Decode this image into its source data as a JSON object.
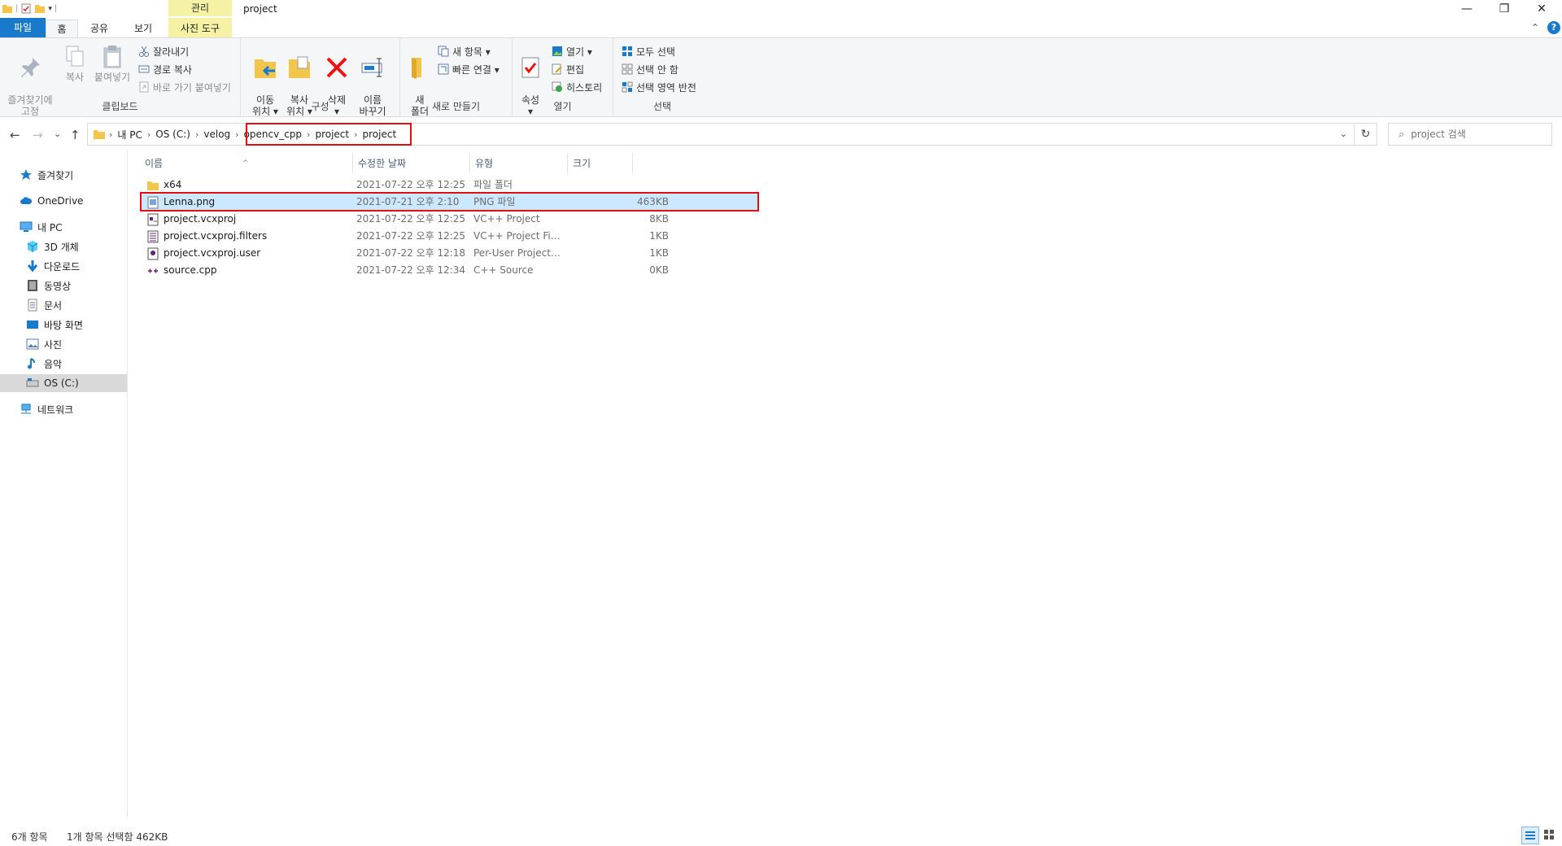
{
  "window": {
    "title": "project",
    "context_tab_label": "관리",
    "minimize": "—",
    "restore": "❐",
    "close": "✕"
  },
  "tabs": {
    "file": "파일",
    "home": "홈",
    "share": "공유",
    "view": "보기",
    "picture_tools": "사진 도구",
    "collapse": "⌃",
    "help": "?"
  },
  "ribbon": {
    "clipboard": {
      "label": "클립보드",
      "pin": "즐겨찾기에\n고정",
      "copy": "복사",
      "paste": "붙여넣기",
      "cut": "잘라내기",
      "copy_path": "경로 복사",
      "paste_shortcut": "바로 가기 붙여넣기"
    },
    "organize": {
      "label": "구성",
      "move_to": "이동\n위치 ▾",
      "copy_to": "복사\n위치 ▾",
      "delete": "삭제\n▾",
      "rename": "이름\n바꾸기"
    },
    "new": {
      "label": "새로 만들기",
      "new_folder": "새\n폴더",
      "new_item": "새 항목 ▾",
      "easy_access": "빠른 연결 ▾"
    },
    "open": {
      "label": "열기",
      "properties": "속성\n▾",
      "open": "열기 ▾",
      "edit": "편집",
      "history": "히스토리"
    },
    "select": {
      "label": "선택",
      "select_all": "모두 선택",
      "select_none": "선택 안 함",
      "invert": "선택 영역 반전"
    }
  },
  "address": {
    "back": "←",
    "forward": "→",
    "recent": "⌄",
    "up": "↑",
    "crumbs": [
      "내 PC",
      "OS (C:)",
      "velog",
      "opencv_cpp",
      "project",
      "project"
    ],
    "dropdown": "⌄",
    "refresh": "↻",
    "search_placeholder": "project 검색",
    "search_icon": "⌕"
  },
  "sidebar": {
    "items": [
      {
        "label": "즐겨찾기",
        "icon": "star-icon"
      },
      {
        "label": "OneDrive",
        "icon": "cloud-icon"
      },
      {
        "label": "내 PC",
        "icon": "pc-icon"
      },
      {
        "label": "3D 개체",
        "icon": "cube-icon"
      },
      {
        "label": "다운로드",
        "icon": "download-icon"
      },
      {
        "label": "동영상",
        "icon": "video-icon"
      },
      {
        "label": "문서",
        "icon": "document-icon"
      },
      {
        "label": "바탕 화면",
        "icon": "desktop-icon"
      },
      {
        "label": "사진",
        "icon": "picture-icon"
      },
      {
        "label": "음악",
        "icon": "music-icon"
      },
      {
        "label": "OS (C:)",
        "icon": "drive-icon"
      },
      {
        "label": "네트워크",
        "icon": "network-icon"
      }
    ]
  },
  "columns": {
    "name": "이름",
    "date": "수정한 날짜",
    "type": "유형",
    "size": "크기",
    "sort_indicator": "^"
  },
  "files": [
    {
      "name": "x64",
      "date": "2021-07-22 오후 12:25",
      "type": "파일 폴더",
      "size": "",
      "icon": "folder-icon"
    },
    {
      "name": "Lenna.png",
      "date": "2021-07-21 오후 2:10",
      "type": "PNG 파일",
      "size": "463KB",
      "icon": "image-file-icon"
    },
    {
      "name": "project.vcxproj",
      "date": "2021-07-22 오후 12:25",
      "type": "VC++ Project",
      "size": "8KB",
      "icon": "vcxproj-icon"
    },
    {
      "name": "project.vcxproj.filters",
      "date": "2021-07-22 오후 12:25",
      "type": "VC++ Project Filt...",
      "size": "1KB",
      "icon": "filters-icon"
    },
    {
      "name": "project.vcxproj.user",
      "date": "2021-07-22 오후 12:18",
      "type": "Per-User Project ...",
      "size": "1KB",
      "icon": "user-file-icon"
    },
    {
      "name": "source.cpp",
      "date": "2021-07-22 오후 12:34",
      "type": "C++ Source",
      "size": "0KB",
      "icon": "cpp-icon"
    }
  ],
  "status": {
    "item_count": "6개 항목",
    "selection": "1개 항목 선택함 462KB"
  },
  "colors": {
    "accent": "#1979ca",
    "selection": "#cce8ff",
    "highlight_box": "#e01010",
    "context_tab": "#f5f2a6"
  }
}
